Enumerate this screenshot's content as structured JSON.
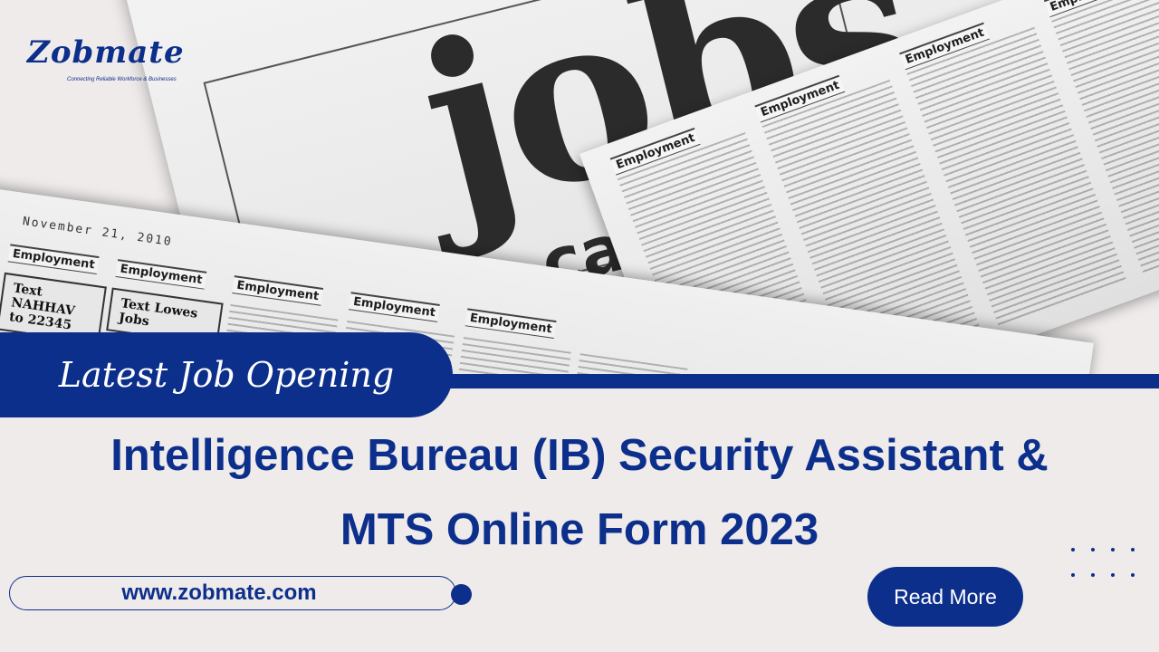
{
  "brand": {
    "name": "Zobmate",
    "tagline": "Connecting Reliable Workforce & Businesses"
  },
  "photo": {
    "headline_word": "jobs",
    "sub_word": "careers",
    "date_text": "November 21, 2010",
    "section_heading": "Employment",
    "ad_1": "Text NAHHAV to 22345",
    "ad_2": "Text Lowes Jobs"
  },
  "banner": {
    "label": "Latest Job Opening",
    "title_line_1": "Intelligence Bureau (IB) Security Assistant &",
    "title_line_2": "MTS Online Form 2023"
  },
  "footer": {
    "website": "www.zobmate.com",
    "cta_label": "Read More"
  },
  "colors": {
    "primary": "#0d2f8c",
    "background": "#efebeb"
  }
}
